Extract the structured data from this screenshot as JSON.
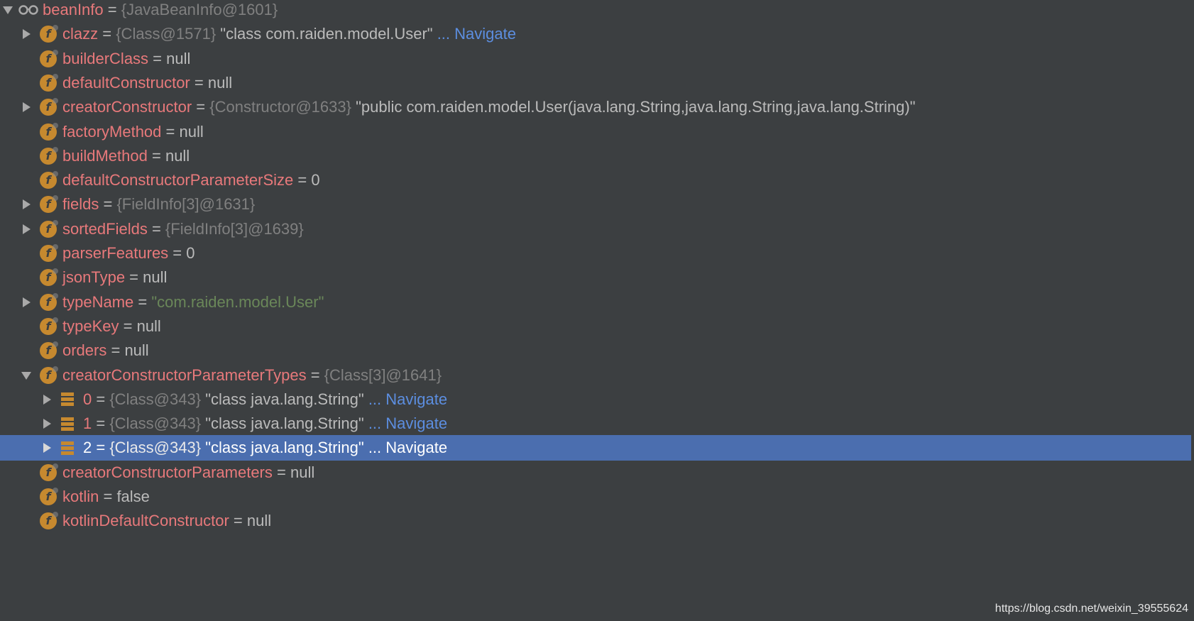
{
  "rows": [
    {
      "level": 0,
      "arrow": "expanded",
      "icon": "watch",
      "name": "beanInfo",
      "eq": " = ",
      "ref": "{JavaBeanInfo@1601}",
      "str": "",
      "green": "",
      "value": "",
      "nav": "",
      "selected": false
    },
    {
      "level": 1,
      "arrow": "collapsed",
      "icon": "field",
      "name": "clazz",
      "eq": " = ",
      "ref": "{Class@1571}",
      "str": " \"class com.raiden.model.User\"",
      "green": "",
      "value": "",
      "nav": " ... Navigate",
      "selected": false
    },
    {
      "level": 1,
      "arrow": "none",
      "icon": "field",
      "name": "builderClass",
      "eq": " = ",
      "ref": "",
      "str": "",
      "green": "",
      "value": "null",
      "nav": "",
      "selected": false
    },
    {
      "level": 1,
      "arrow": "none",
      "icon": "field",
      "name": "defaultConstructor",
      "eq": " = ",
      "ref": "",
      "str": "",
      "green": "",
      "value": "null",
      "nav": "",
      "selected": false
    },
    {
      "level": 1,
      "arrow": "collapsed",
      "icon": "field",
      "name": "creatorConstructor",
      "eq": " = ",
      "ref": "{Constructor@1633}",
      "str": " \"public com.raiden.model.User(java.lang.String,java.lang.String,java.lang.String)\"",
      "green": "",
      "value": "",
      "nav": "",
      "selected": false
    },
    {
      "level": 1,
      "arrow": "none",
      "icon": "field",
      "name": "factoryMethod",
      "eq": " = ",
      "ref": "",
      "str": "",
      "green": "",
      "value": "null",
      "nav": "",
      "selected": false
    },
    {
      "level": 1,
      "arrow": "none",
      "icon": "field",
      "name": "buildMethod",
      "eq": " = ",
      "ref": "",
      "str": "",
      "green": "",
      "value": "null",
      "nav": "",
      "selected": false
    },
    {
      "level": 1,
      "arrow": "none",
      "icon": "field",
      "name": "defaultConstructorParameterSize",
      "eq": " = ",
      "ref": "",
      "str": "",
      "green": "",
      "value": "0",
      "nav": "",
      "selected": false
    },
    {
      "level": 1,
      "arrow": "collapsed",
      "icon": "field",
      "name": "fields",
      "eq": " = ",
      "ref": "{FieldInfo[3]@1631}",
      "str": "",
      "green": "",
      "value": "",
      "nav": "",
      "selected": false
    },
    {
      "level": 1,
      "arrow": "collapsed",
      "icon": "field",
      "name": "sortedFields",
      "eq": " = ",
      "ref": "{FieldInfo[3]@1639}",
      "str": "",
      "green": "",
      "value": "",
      "nav": "",
      "selected": false
    },
    {
      "level": 1,
      "arrow": "none",
      "icon": "field",
      "name": "parserFeatures",
      "eq": " = ",
      "ref": "",
      "str": "",
      "green": "",
      "value": "0",
      "nav": "",
      "selected": false
    },
    {
      "level": 1,
      "arrow": "none",
      "icon": "field",
      "name": "jsonType",
      "eq": " = ",
      "ref": "",
      "str": "",
      "green": "",
      "value": "null",
      "nav": "",
      "selected": false
    },
    {
      "level": 1,
      "arrow": "collapsed",
      "icon": "field",
      "name": "typeName",
      "eq": " = ",
      "ref": "",
      "str": "",
      "green": "\"com.raiden.model.User\"",
      "value": "",
      "nav": "",
      "selected": false
    },
    {
      "level": 1,
      "arrow": "none",
      "icon": "field",
      "name": "typeKey",
      "eq": " = ",
      "ref": "",
      "str": "",
      "green": "",
      "value": "null",
      "nav": "",
      "selected": false
    },
    {
      "level": 1,
      "arrow": "none",
      "icon": "field",
      "name": "orders",
      "eq": " = ",
      "ref": "",
      "str": "",
      "green": "",
      "value": "null",
      "nav": "",
      "selected": false
    },
    {
      "level": 1,
      "arrow": "expanded",
      "icon": "field",
      "name": "creatorConstructorParameterTypes",
      "eq": " = ",
      "ref": "{Class[3]@1641}",
      "str": "",
      "green": "",
      "value": "",
      "nav": "",
      "selected": false
    },
    {
      "level": 2,
      "arrow": "collapsed",
      "icon": "array",
      "name": "0",
      "eq": " = ",
      "ref": "{Class@343}",
      "str": " \"class java.lang.String\"",
      "green": "",
      "value": "",
      "nav": " ... Navigate",
      "selected": false
    },
    {
      "level": 2,
      "arrow": "collapsed",
      "icon": "array",
      "name": "1",
      "eq": " = ",
      "ref": "{Class@343}",
      "str": " \"class java.lang.String\"",
      "green": "",
      "value": "",
      "nav": " ... Navigate",
      "selected": false
    },
    {
      "level": 2,
      "arrow": "collapsed",
      "icon": "array",
      "name": "2",
      "eq": " = ",
      "ref": "{Class@343}",
      "str": " \"class java.lang.String\"",
      "green": "",
      "value": "",
      "nav": " ... Navigate",
      "selected": true
    },
    {
      "level": 1,
      "arrow": "none",
      "icon": "field",
      "name": "creatorConstructorParameters",
      "eq": " = ",
      "ref": "",
      "str": "",
      "green": "",
      "value": "null",
      "nav": "",
      "selected": false
    },
    {
      "level": 1,
      "arrow": "none",
      "icon": "field",
      "name": "kotlin",
      "eq": " = ",
      "ref": "",
      "str": "",
      "green": "",
      "value": "false",
      "nav": "",
      "selected": false
    },
    {
      "level": 1,
      "arrow": "none",
      "icon": "field",
      "name": "kotlinDefaultConstructor",
      "eq": " = ",
      "ref": "",
      "str": "",
      "green": "",
      "value": "null",
      "nav": "",
      "selected": false
    }
  ],
  "field_icon_letter": "f",
  "watermark": "https://blog.csdn.net/weixin_39555624",
  "colors": {
    "background": "#3c3f41",
    "selection": "#4b6eaf",
    "field_name": "#e8797b",
    "reference": "#808080",
    "navigate_link": "#5c8ee0",
    "string_literal": "#6a8759",
    "field_icon": "#c6892f"
  }
}
